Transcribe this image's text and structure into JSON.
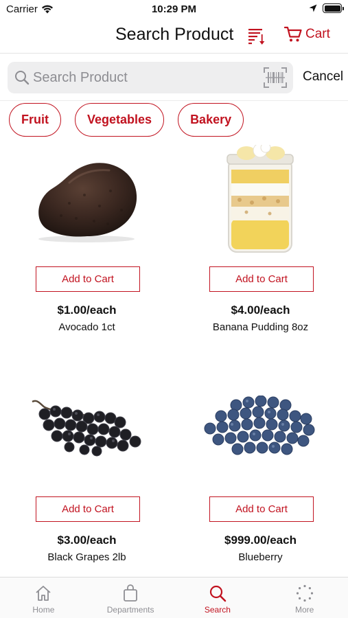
{
  "status_bar": {
    "carrier": "Carrier",
    "time": "10:29 PM"
  },
  "nav": {
    "title": "Search Product",
    "cart_label": "Cart"
  },
  "search": {
    "placeholder": "Search Product",
    "value": "",
    "cancel_label": "Cancel"
  },
  "categories": [
    {
      "label": "Fruit"
    },
    {
      "label": "Vegetables"
    },
    {
      "label": "Bakery"
    }
  ],
  "products": [
    {
      "price": "$1.00/each",
      "name": "Avocado 1ct",
      "button_label": "Add to Cart",
      "image": "avocado"
    },
    {
      "price": "$4.00/each",
      "name": "Banana Pudding 8oz",
      "button_label": "Add to Cart",
      "image": "banana-pudding-jar"
    },
    {
      "price": "$3.00/each",
      "name": "Black Grapes 2lb",
      "button_label": "Add to Cart",
      "image": "black-grapes"
    },
    {
      "price": "$999.00/each",
      "name": "Blueberry",
      "button_label": "Add to Cart",
      "image": "blueberries"
    }
  ],
  "tab_bar": {
    "items": [
      {
        "label": "Home",
        "icon": "home-icon"
      },
      {
        "label": "Departments",
        "icon": "shopping-bag-icon"
      },
      {
        "label": "Search",
        "icon": "search-icon",
        "active": true
      },
      {
        "label": "More",
        "icon": "more-dots-icon"
      }
    ]
  },
  "colors": {
    "accent": "#c1121f",
    "inactive_tab": "#8e8e93",
    "search_bg": "#eeeeef"
  }
}
